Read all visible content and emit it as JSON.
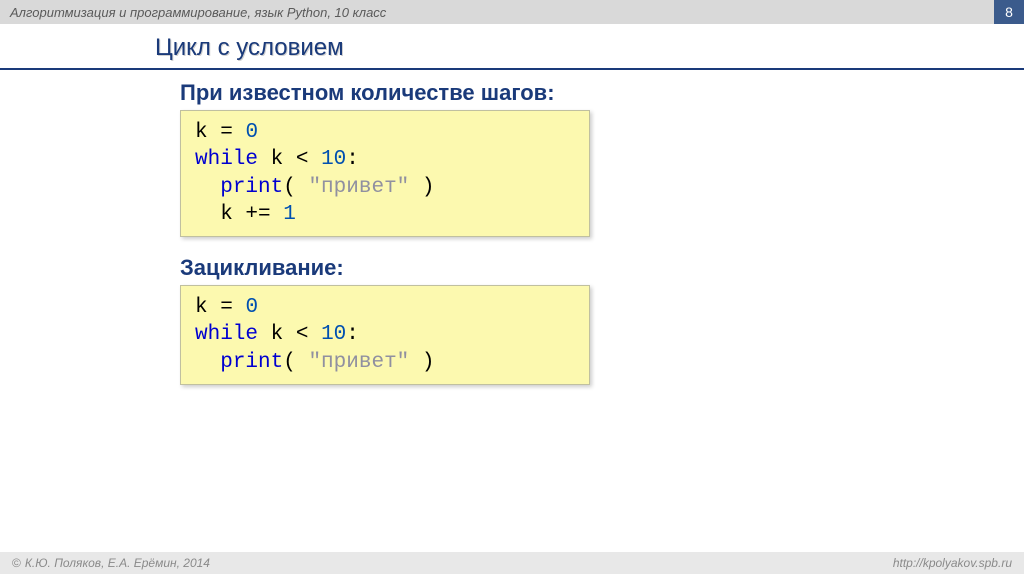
{
  "header": {
    "course_title": "Алгоритмизация и программирование, язык Python, 10 класс",
    "page_number": "8"
  },
  "title": "Цикл с условием",
  "section1": {
    "heading": "При известном количестве шагов:",
    "code": {
      "l1a": "k",
      "l1b": "=",
      "l1c": "0",
      "l2a": "while",
      "l2b": "k",
      "l2c": "<",
      "l2d": "10",
      "l2e": ":",
      "l3a": "print",
      "l3b": "( ",
      "l3c": "\"привет\"",
      "l3d": " )",
      "l4a": "k += ",
      "l4b": "1"
    }
  },
  "section2": {
    "heading": "Зацикливание:",
    "code": {
      "l1a": "k",
      "l1b": "=",
      "l1c": "0",
      "l2a": "while",
      "l2b": " k",
      "l2c": "<",
      "l2d": "10",
      "l2e": ":",
      "l3a": "print",
      "l3b": "( ",
      "l3c": "\"привет\"",
      "l3d": " )"
    }
  },
  "footer": {
    "copyright": "К.Ю. Поляков, Е.А. Ерёмин, 2014",
    "url": "http://kpolyakov.spb.ru"
  }
}
